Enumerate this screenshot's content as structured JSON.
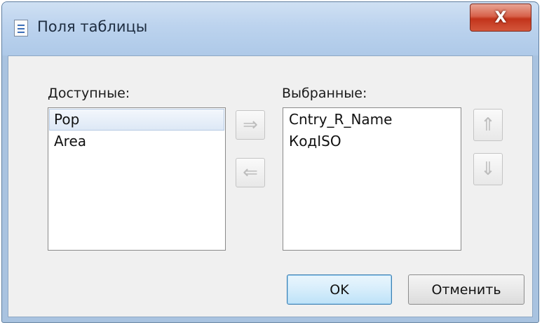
{
  "window": {
    "title": "Поля таблицы",
    "close_label": "X"
  },
  "available": {
    "label": "Доступные:",
    "items": [
      "Pop",
      "Area"
    ],
    "selected_index": 0
  },
  "selected": {
    "label": "Выбранные:",
    "items": [
      "Cntry_R_Name",
      "КодISO"
    ]
  },
  "arrows": {
    "add": "⇒",
    "remove": "⇐",
    "up": "⇑",
    "down": "⇓"
  },
  "buttons": {
    "ok": "OK",
    "cancel": "Отменить"
  },
  "colors": {
    "title_bar": "#bcd3ee",
    "close_button": "#c2341b",
    "selection": "#dde8f6",
    "dialog_background": "#f0f0f0"
  }
}
